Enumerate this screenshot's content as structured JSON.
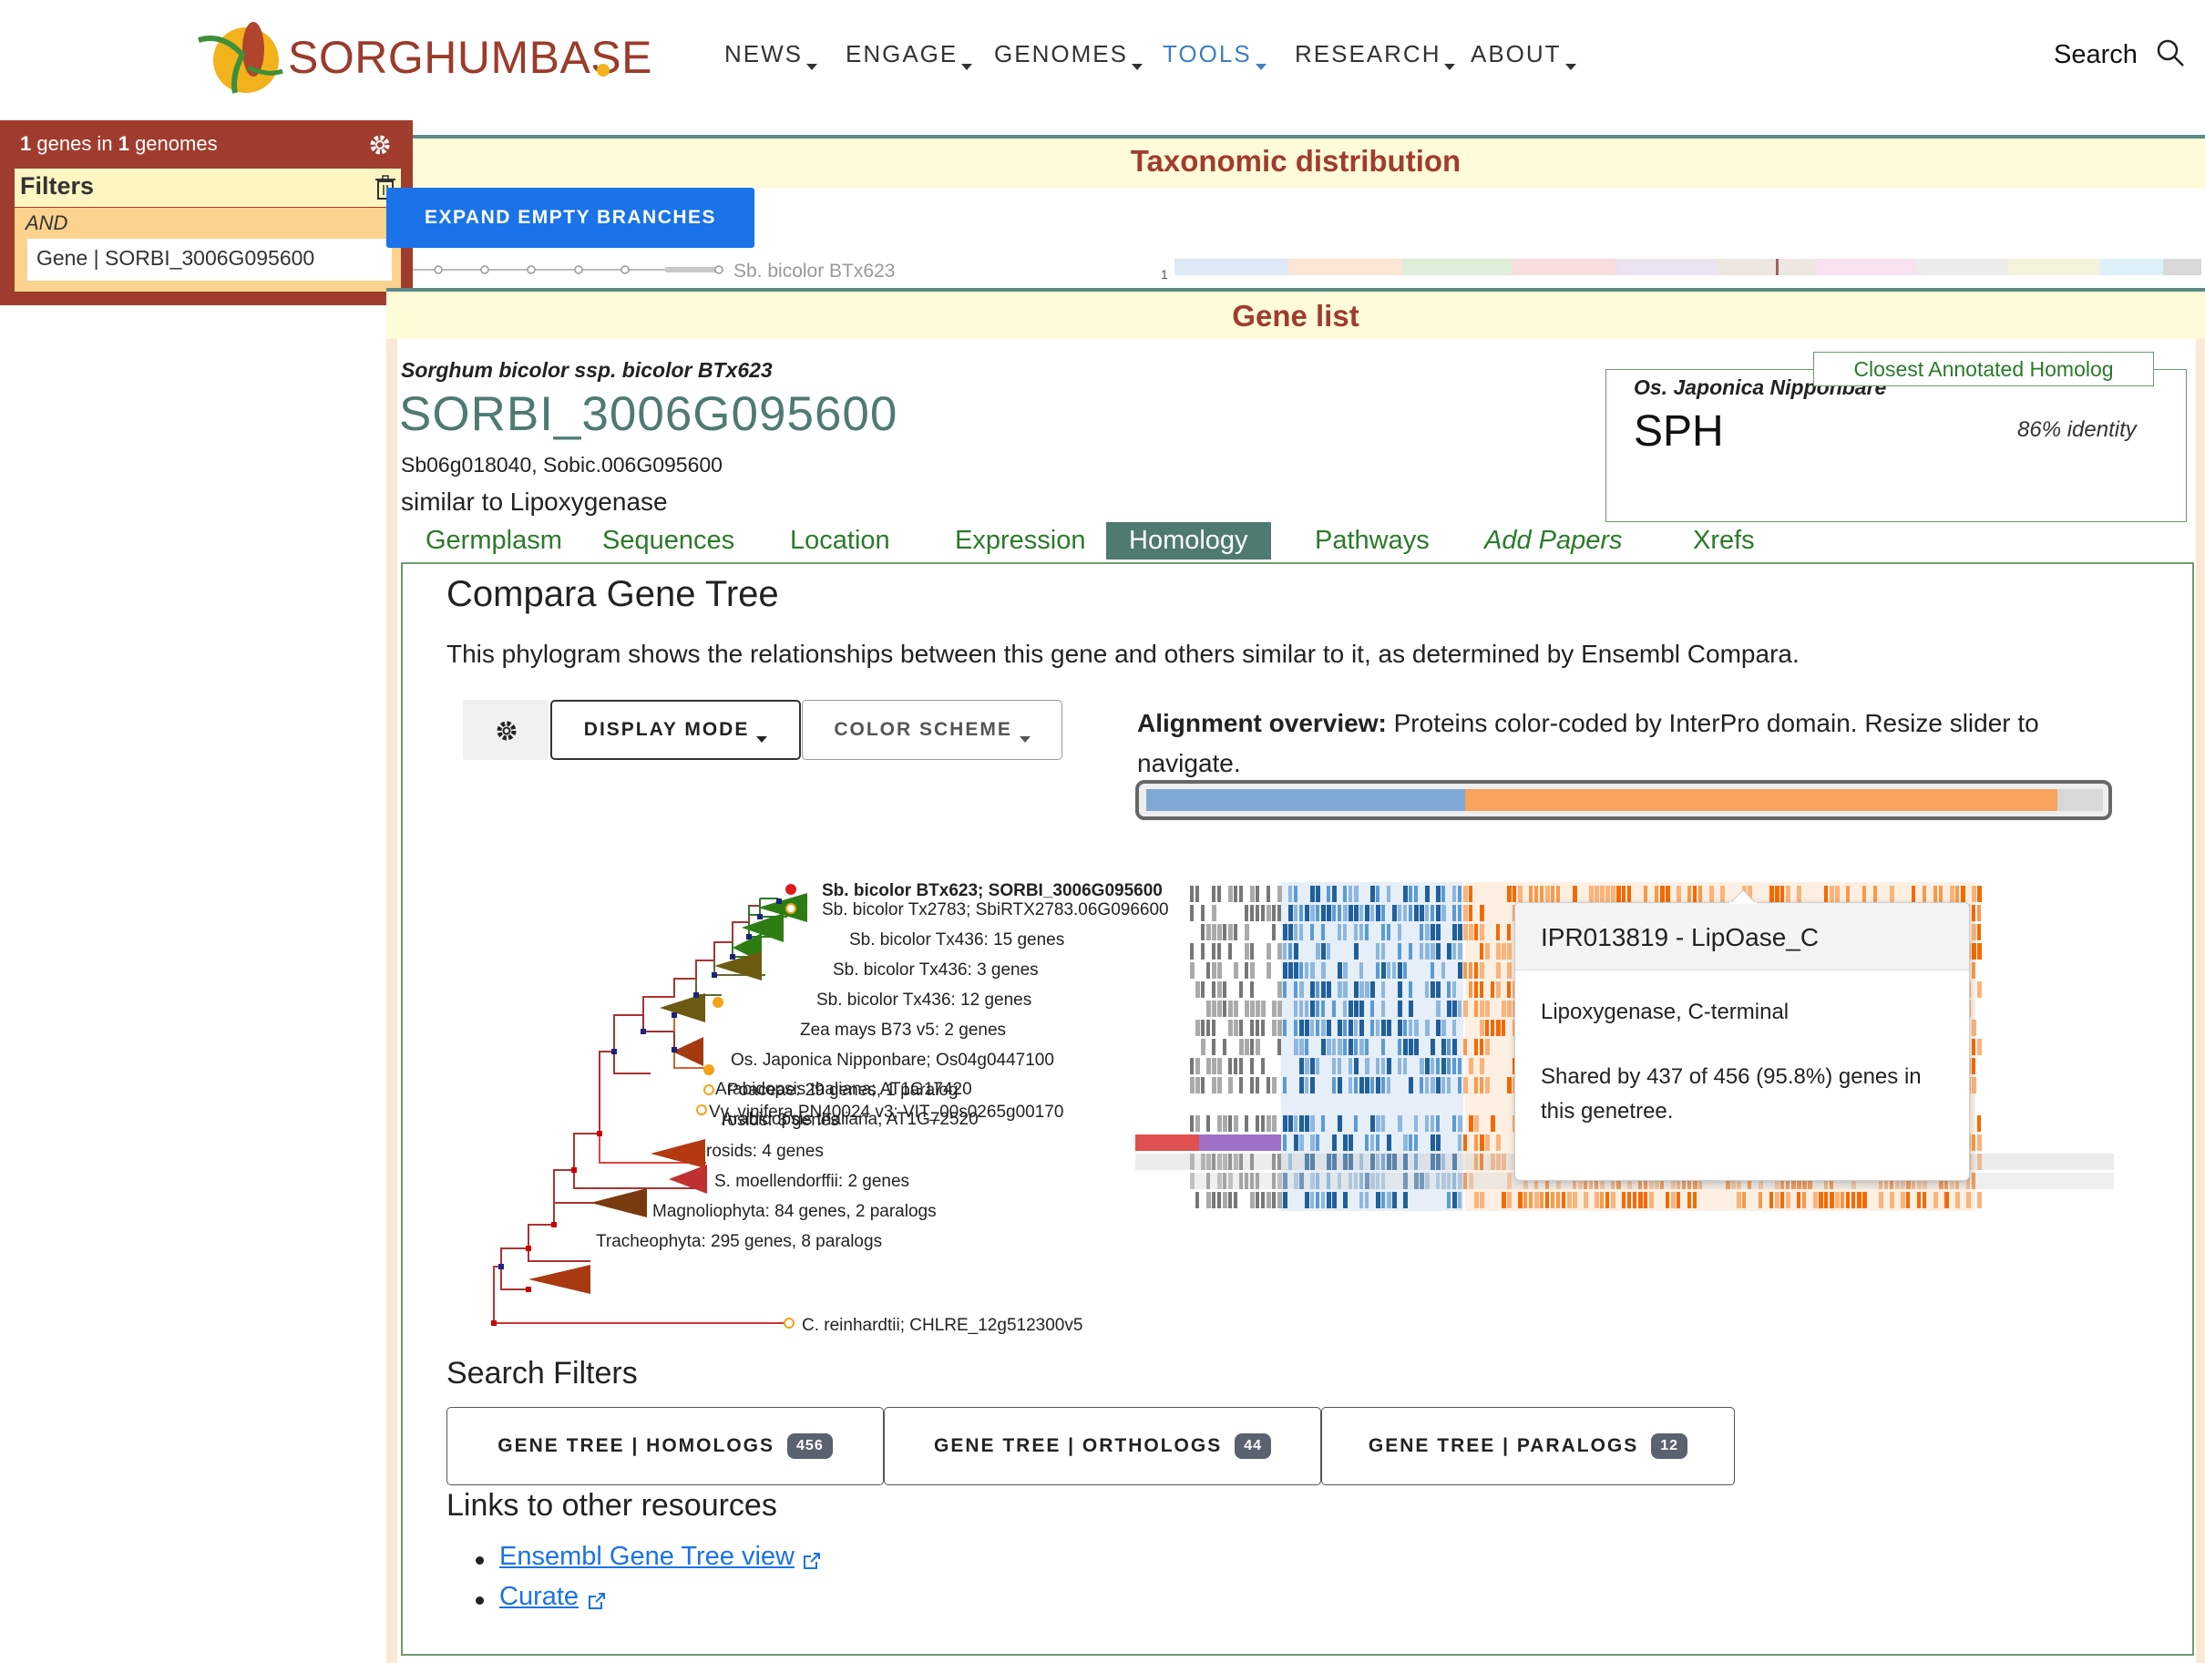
{
  "header": {
    "logo": "SORGHUMBASE",
    "nav": [
      {
        "label": "NEWS"
      },
      {
        "label": "ENGAGE"
      },
      {
        "label": "GENOMES"
      },
      {
        "label": "TOOLS"
      },
      {
        "label": "RESEARCH"
      },
      {
        "label": "ABOUT"
      }
    ],
    "search_label": "Search"
  },
  "filter_panel": {
    "genes_count": "1",
    "genes_text": "genes in",
    "genomes_count": "1",
    "genomes_text": "genomes",
    "filters_label": "Filters",
    "operator": "AND",
    "filter_value": "Gene | SORBI_3006G095600"
  },
  "taxonomy": {
    "title": "Taxonomic distribution",
    "expand_button": "EXPAND EMPTY BRANCHES",
    "leaf_label": "Sb. bicolor BTx623",
    "count": "1"
  },
  "gene_list": {
    "title": "Gene list",
    "species": "Sorghum bicolor ssp. bicolor BTx623",
    "gene_id": "SORBI_3006G095600",
    "synonyms": "Sb06g018040, Sobic.006G095600",
    "description": "similar to Lipoxygenase",
    "homolog": {
      "tag": "Closest Annotated Homolog",
      "species": "Os. Japonica Nipponbare",
      "name": "SPH",
      "identity": "86% identity"
    },
    "tabs": [
      "Germplasm",
      "Sequences",
      "Location",
      "Expression",
      "Homology",
      "Pathways",
      "Add Papers",
      "Xrefs"
    ]
  },
  "homology": {
    "title": "Compara Gene Tree",
    "description": "This phylogram shows the relationships between this gene and others similar to it, as determined by Ensembl Compara.",
    "display_mode": "DISPLAY MODE",
    "color_scheme": "COLOR SCHEME",
    "alignment_bold": "Alignment overview:",
    "alignment_text": " Proteins color-coded by InterPro domain. Resize slider to navigate.",
    "tree_labels": [
      "Sb. bicolor BTx623; SORBI_3006G095600",
      "Sb. bicolor Tx2783; SbiRTX2783.06G096600",
      "Sb. bicolor Tx436: 15 genes",
      "Sb. bicolor Tx436: 3 genes",
      "Sb. bicolor Tx436: 12 genes",
      "Zea mays B73 v5: 2 genes",
      "Os. Japonica Nipponbare; Os04g0447100",
      "Poaceae: 29 genes, 1 paralog",
      "rosids: 3 genes",
      "Arabidopsis thaliana; AT1G17420",
      "Arabidopsis thaliana; AT1G72520",
      "Vv. vinifera PN40024 v3; VIT_00s0265g00170",
      "rosids: 4 genes",
      "S. moellendorffii: 2 genes",
      "Magnoliophyta: 84 genes, 2 paralogs",
      "Tracheophyta: 295 genes, 8 paralogs",
      "C. reinhardtii; CHLRE_12g512300v5"
    ],
    "tooltip": {
      "title": "IPR013819 - LipOase_C",
      "desc": "Lipoxygenase, C-terminal",
      "shared": "Shared by 437 of 456 (95.8%) genes in this genetree."
    },
    "colors": {
      "domain_blue": "#2f7fc4",
      "domain_orange": "#f7841f",
      "selected": "#e31a1c"
    }
  },
  "search_filters": {
    "title": "Search Filters",
    "buttons": [
      {
        "label": "GENE TREE | HOMOLOGS",
        "count": "456"
      },
      {
        "label": "GENE TREE | ORTHOLOGS",
        "count": "44"
      },
      {
        "label": "GENE TREE | PARALOGS",
        "count": "12"
      }
    ]
  },
  "links": {
    "title": "Links to other resources",
    "items": [
      "Ensembl Gene Tree view",
      "Curate"
    ]
  }
}
